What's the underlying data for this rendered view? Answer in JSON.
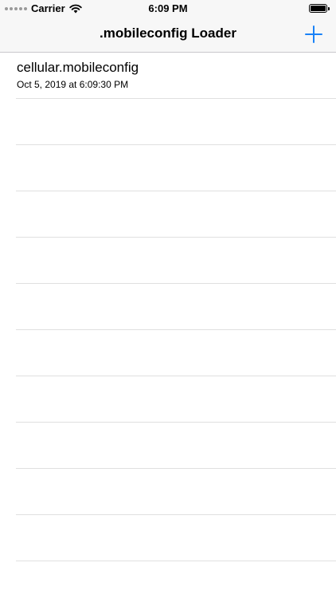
{
  "status_bar": {
    "carrier": "Carrier",
    "time": "6:09 PM"
  },
  "nav": {
    "title": ".mobileconfig Loader",
    "add_icon": "plus-icon"
  },
  "colors": {
    "accent": "#1a82f7",
    "separator": "#e0e0e0",
    "bar_background": "#f7f7f7"
  },
  "files": [
    {
      "name": "cellular.mobileconfig",
      "date": "Oct 5, 2019 at 6:09:30 PM"
    }
  ]
}
